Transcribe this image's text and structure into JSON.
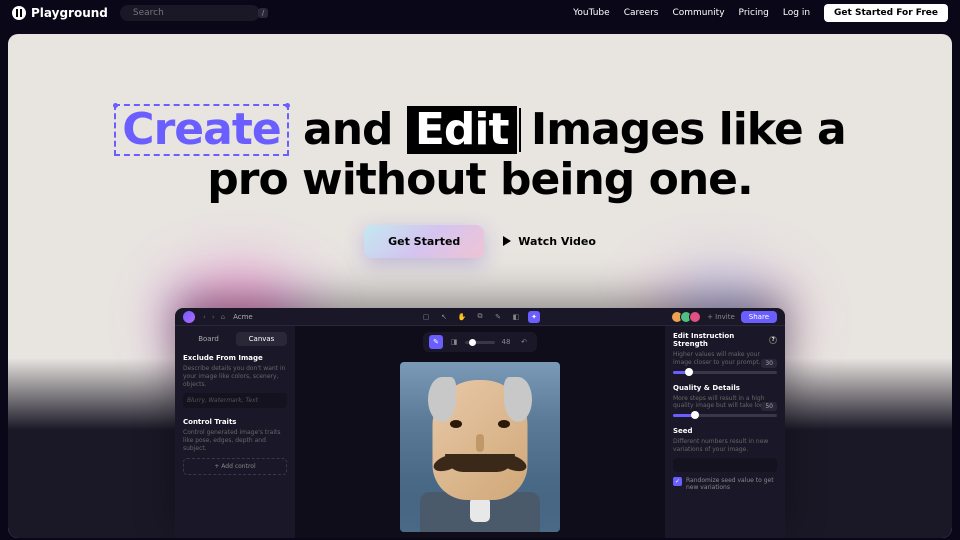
{
  "nav": {
    "brand": "Playground",
    "search_placeholder": "Search",
    "search_key": "/",
    "links": [
      "YouTube",
      "Careers",
      "Community",
      "Pricing",
      "Log in"
    ],
    "cta": "Get Started For Free"
  },
  "hero": {
    "word_create": "Create",
    "word_and": " and ",
    "word_edit": "Edit",
    "rest1": " Images like a",
    "rest2": "pro without being one.",
    "get_started": "Get Started",
    "watch_video": "Watch Video"
  },
  "app": {
    "title": "Acme",
    "invite": "+ Invite",
    "share": "Share",
    "tabs": {
      "board": "Board",
      "canvas": "Canvas"
    },
    "left": {
      "exclude_title": "Exclude From Image",
      "exclude_desc": "Describe details you don't want in your image like colors, scenery, objects.",
      "exclude_ph": "Blurry, Watermark, Text",
      "traits_title": "Control Traits",
      "traits_desc": "Control generated image's traits like pose, edges, depth and subject.",
      "add_control": "+ Add control"
    },
    "canvas": {
      "val": "48"
    },
    "right": {
      "strength_title": "Edit Instruction Strength",
      "strength_desc": "Higher values will make your image closer to your prompt.",
      "strength_val": "30",
      "quality_title": "Quality & Details",
      "quality_desc": "More steps will result in a high quality image but will take longer.",
      "quality_val": "50",
      "seed_title": "Seed",
      "seed_desc": "Different numbers result in new variations of your image.",
      "randomize": "Randomize seed value to get new variations"
    }
  }
}
